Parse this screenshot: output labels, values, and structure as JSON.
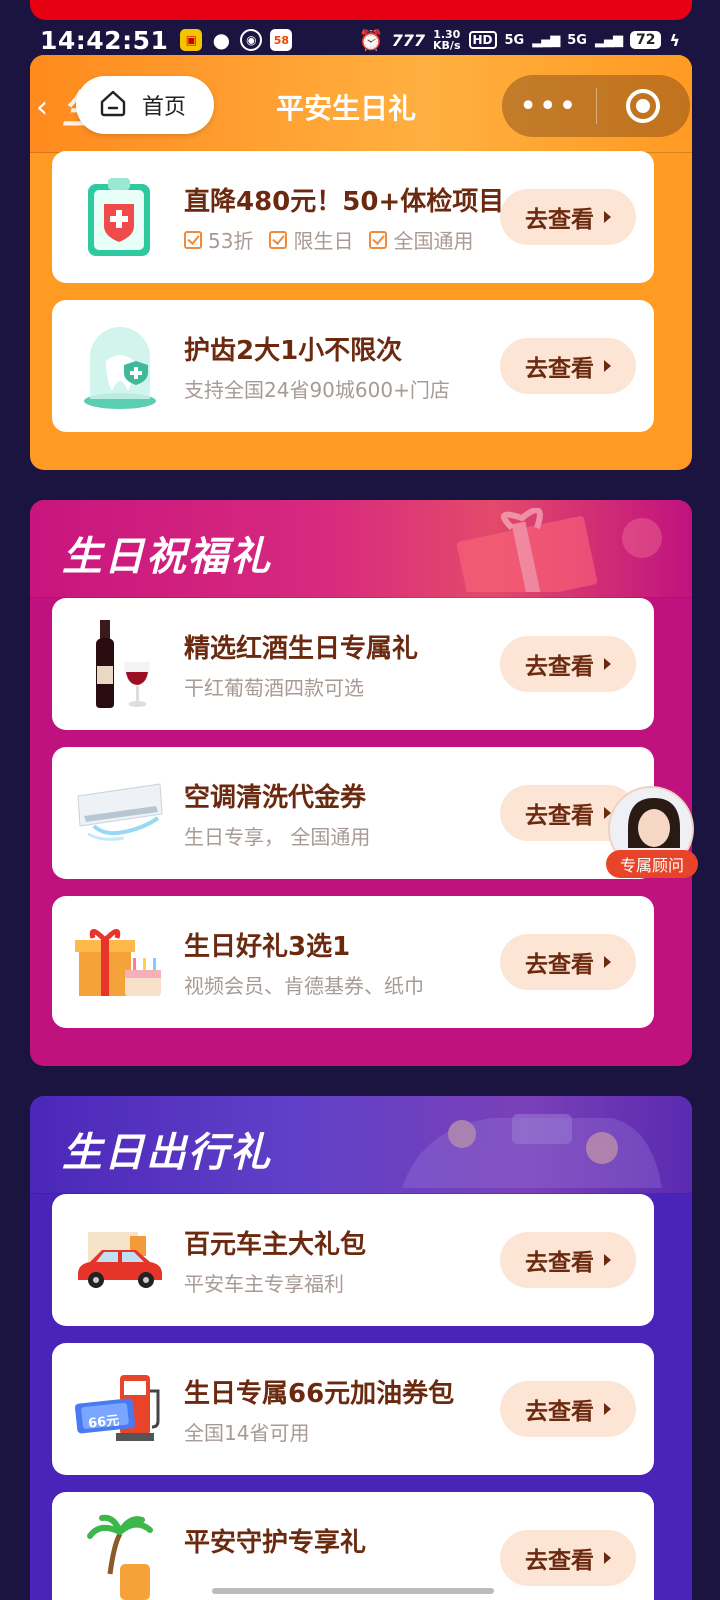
{
  "status": {
    "time": "14:42:51",
    "net_speed_top": "1.30",
    "net_speed_bottom": "KB/s",
    "battery": "72",
    "hd": "HD",
    "sig1": "5G",
    "sig2": "5G"
  },
  "nav": {
    "home_label": "首页",
    "title": "平安生日礼",
    "ghost_title": "生日礼"
  },
  "section1": {
    "cards": [
      {
        "title": "直降480元！50+体检项目",
        "tags": [
          "53折",
          "限生日",
          "全国通用"
        ],
        "button": "去查看"
      },
      {
        "title": "护齿2大1小不限次",
        "sub": "支持全国24省90城600+门店",
        "button": "去查看"
      }
    ]
  },
  "section2": {
    "title": "生日祝福礼",
    "cards": [
      {
        "title": "精选红酒生日专属礼",
        "sub": "干红葡萄酒四款可选",
        "button": "去查看"
      },
      {
        "title": "空调清洗代金券",
        "sub": "生日专享， 全国通用",
        "button": "去查看"
      },
      {
        "title": "生日好礼3选1",
        "sub": "视频会员、肯德基券、纸巾",
        "button": "去查看"
      }
    ]
  },
  "section3": {
    "title": "生日出行礼",
    "cards": [
      {
        "title": "百元车主大礼包",
        "sub": "平安车主专享福利",
        "button": "去查看"
      },
      {
        "title": "生日专属66元加油券包",
        "sub": "全国14省可用",
        "button": "去查看",
        "badge": "66元"
      },
      {
        "title": "平安守护专享礼",
        "sub": "",
        "button": "去查看"
      }
    ]
  },
  "advisor": {
    "label": "专属顾问"
  },
  "colors": {
    "orange": "#ff9a22",
    "pink": "#c0127f",
    "purple": "#4a24b8",
    "button_bg": "#fde5d6",
    "title_text": "#6b2a10"
  }
}
